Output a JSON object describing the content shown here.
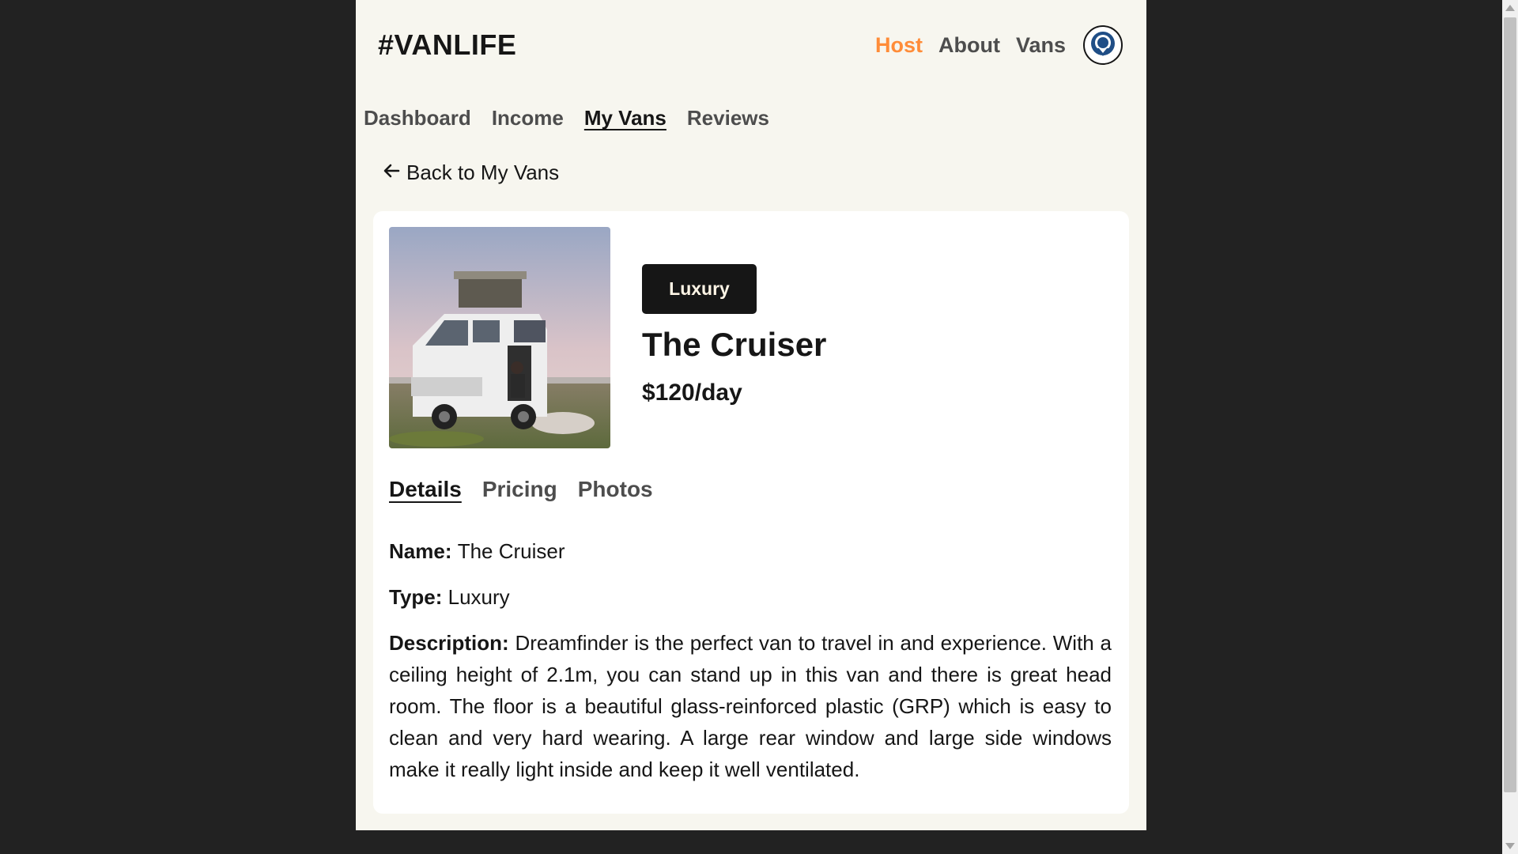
{
  "header": {
    "logo": "#VANLIFE",
    "nav": [
      {
        "label": "Host",
        "active": true
      },
      {
        "label": "About",
        "active": false
      },
      {
        "label": "Vans",
        "active": false
      }
    ],
    "avatar_icon": "user-avatar-icon"
  },
  "host_nav": [
    {
      "label": "Dashboard",
      "active": false
    },
    {
      "label": "Income",
      "active": false
    },
    {
      "label": "My Vans",
      "active": true
    },
    {
      "label": "Reviews",
      "active": false
    }
  ],
  "back_link": {
    "icon": "arrow-left-icon",
    "label": "Back to My Vans"
  },
  "van": {
    "type_badge": "Luxury",
    "name": "The Cruiser",
    "price": "$120/day"
  },
  "tabs": [
    {
      "label": "Details",
      "active": true
    },
    {
      "label": "Pricing",
      "active": false
    },
    {
      "label": "Photos",
      "active": false
    }
  ],
  "details": {
    "name_label": "Name:",
    "name_value": "The Cruiser",
    "type_label": "Type:",
    "type_value": "Luxury",
    "description_label": "Description:",
    "description_value": "Dreamfinder is the perfect van to travel in and experience. With a ceiling height of 2.1m, you can stand up in this van and there is great head room. The floor is a beautiful glass-reinforced plastic (GRP) which is easy to clean and very hard wearing. A large rear window and large side windows make it really light inside and keep it well ventilated."
  },
  "colors": {
    "page_bg": "#f7f6ef",
    "outer_bg": "#222222",
    "accent": "#ff8c38",
    "dark": "#161616",
    "muted": "#4d4d4d"
  }
}
